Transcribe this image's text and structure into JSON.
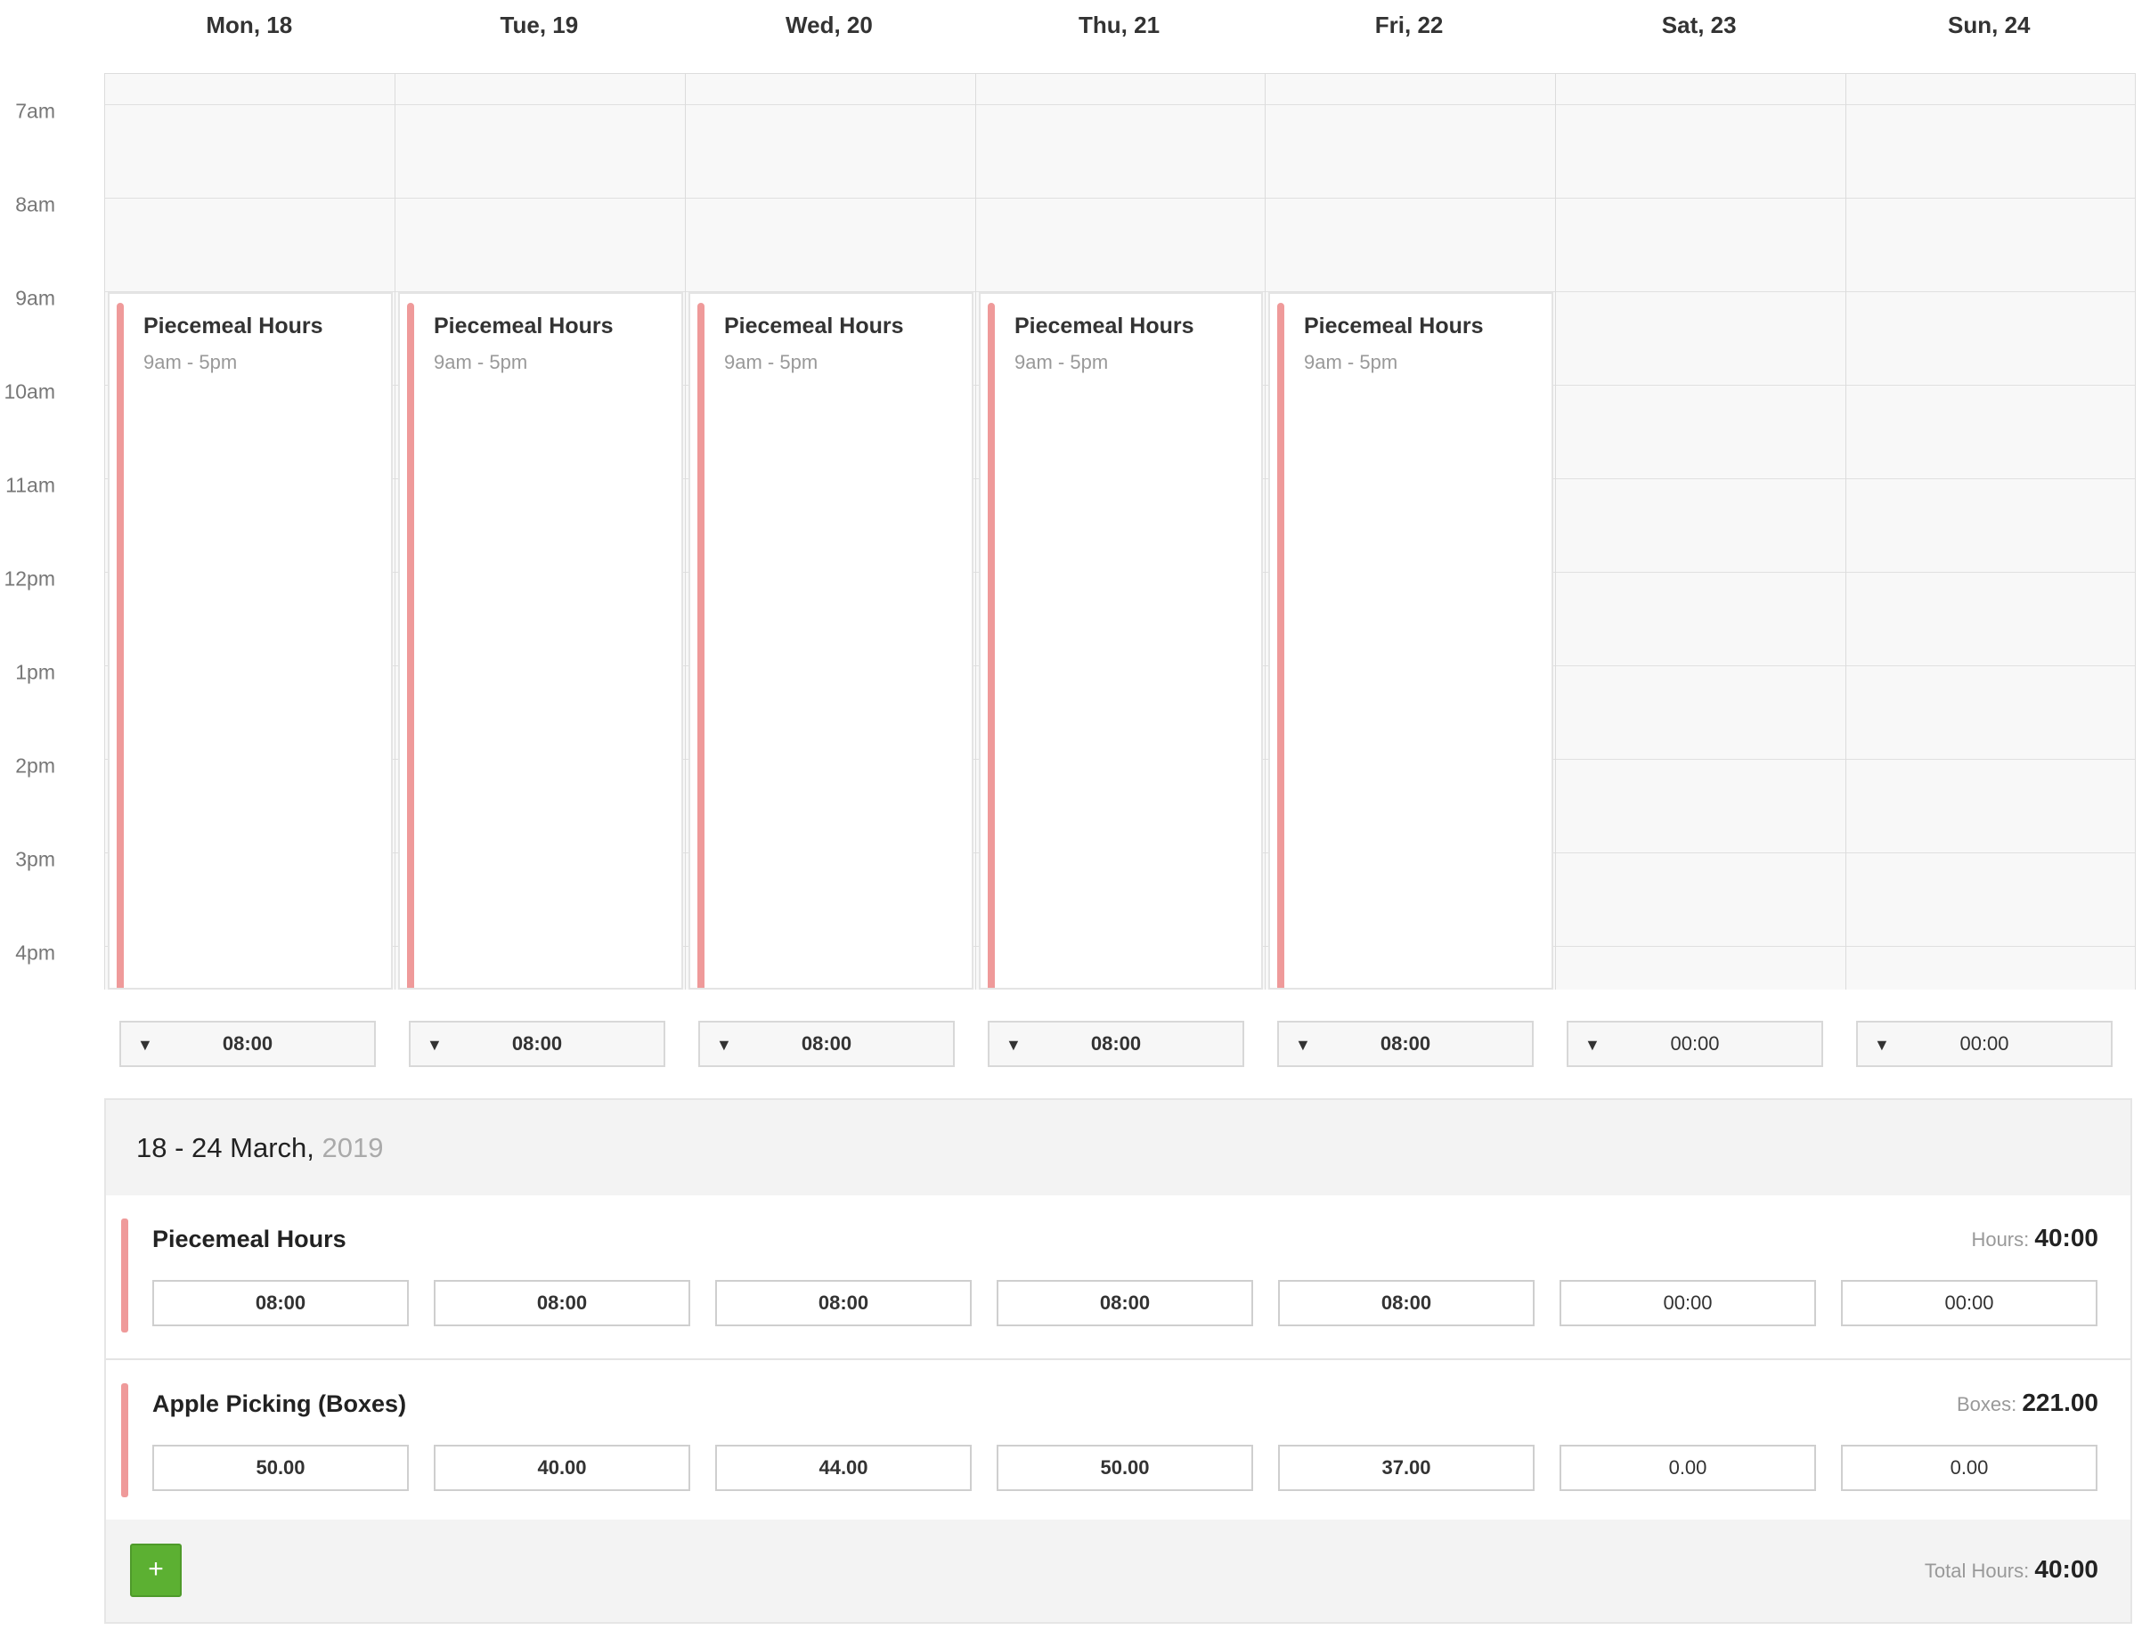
{
  "days": [
    {
      "label": "Mon, 18",
      "has_event": true,
      "total": "08:00"
    },
    {
      "label": "Tue, 19",
      "has_event": true,
      "total": "08:00"
    },
    {
      "label": "Wed, 20",
      "has_event": true,
      "total": "08:00"
    },
    {
      "label": "Thu, 21",
      "has_event": true,
      "total": "08:00"
    },
    {
      "label": "Fri, 22",
      "has_event": true,
      "total": "08:00"
    },
    {
      "label": "Sat, 23",
      "has_event": false,
      "total": "00:00"
    },
    {
      "label": "Sun, 24",
      "has_event": false,
      "total": "00:00"
    }
  ],
  "time_labels": [
    "7am",
    "8am",
    "9am",
    "10am",
    "11am",
    "12pm",
    "1pm",
    "2pm",
    "3pm",
    "4pm"
  ],
  "event": {
    "title": "Piecemeal Hours",
    "time": "9am - 5pm"
  },
  "icons": {
    "dropdown": "caret-down-icon",
    "add": "plus-icon"
  },
  "colors": {
    "event_accent": "#ef9a9a",
    "add_button": "#5cb032"
  },
  "summary": {
    "week_range": "18 - 24 March,",
    "year": "2019",
    "rows": [
      {
        "title": "Piecemeal Hours",
        "total_label": "Hours:",
        "total_value": "40:00",
        "values": [
          "08:00",
          "08:00",
          "08:00",
          "08:00",
          "08:00",
          "00:00",
          "00:00"
        ]
      },
      {
        "title": "Apple Picking (Boxes)",
        "total_label": "Boxes:",
        "total_value": "221.00",
        "values": [
          "50.00",
          "40.00",
          "44.00",
          "50.00",
          "37.00",
          "0.00",
          "0.00"
        ]
      }
    ],
    "add_label": "+",
    "total_hours_label": "Total Hours:",
    "total_hours_value": "40:00"
  }
}
